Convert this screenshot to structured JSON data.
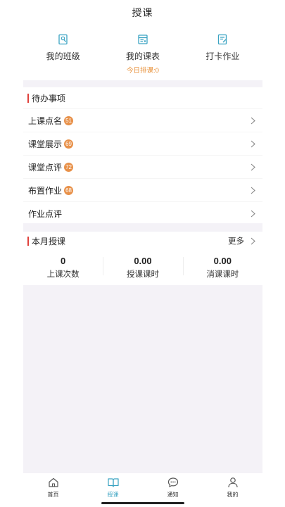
{
  "header": {
    "title": "授课"
  },
  "shortcuts": [
    {
      "label": "我的班级",
      "icon": "class-icon"
    },
    {
      "label": "我的课表",
      "icon": "schedule-icon",
      "sub": "今日排课:0"
    },
    {
      "label": "打卡作业",
      "icon": "homework-icon"
    }
  ],
  "todo": {
    "title": "待办事项",
    "items": [
      {
        "label": "上课点名",
        "badge": "51"
      },
      {
        "label": "课堂展示",
        "badge": "69"
      },
      {
        "label": "课堂点评",
        "badge": "72"
      },
      {
        "label": "布置作业",
        "badge": "68"
      },
      {
        "label": "作业点评"
      }
    ]
  },
  "monthly": {
    "title": "本月授课",
    "more_label": "更多",
    "stats": [
      {
        "value": "0",
        "label": "上课次数"
      },
      {
        "value": "0.00",
        "label": "授课课时"
      },
      {
        "value": "0.00",
        "label": "消课课时"
      }
    ]
  },
  "tabs": [
    {
      "label": "首页",
      "icon": "home-icon"
    },
    {
      "label": "授课",
      "icon": "book-icon",
      "active": true
    },
    {
      "label": "通知",
      "icon": "chat-icon"
    },
    {
      "label": "我的",
      "icon": "user-icon"
    }
  ],
  "colors": {
    "accent": "#3aa3c2",
    "badge": "#e8914a",
    "section_bar": "#e0413b",
    "sub_text": "#e8913a"
  }
}
